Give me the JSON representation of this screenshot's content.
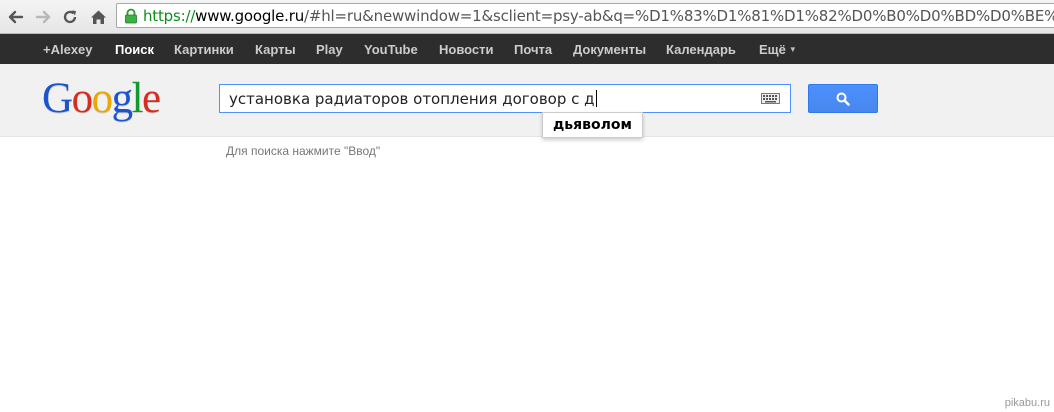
{
  "browser": {
    "url_scheme": "https://",
    "url_host": "www.google.ru",
    "url_rest": "/#hl=ru&newwindow=1&sclient=psy-ab&q=%D1%83%D1%81%D1%82%D0%B0%D0%BD%D0%BE%D0%B2%D0%"
  },
  "gbar": {
    "items": [
      {
        "label": "+Alexey"
      },
      {
        "label": "Поиск"
      },
      {
        "label": "Картинки"
      },
      {
        "label": "Карты"
      },
      {
        "label": "Play"
      },
      {
        "label": "YouTube"
      },
      {
        "label": "Новости"
      },
      {
        "label": "Почта"
      },
      {
        "label": "Документы"
      },
      {
        "label": "Календарь"
      },
      {
        "label": "Ещё"
      }
    ]
  },
  "logo": {
    "letters": [
      "G",
      "o",
      "o",
      "g",
      "l",
      "e"
    ],
    "colors": [
      "#1a54d1",
      "#d62d20",
      "#e8a800",
      "#1a54d1",
      "#119a2c",
      "#d62d20"
    ]
  },
  "search": {
    "query": "установка радиаторов отопления договор с д",
    "suggestion": "дьяволом",
    "hint": "Для поиска нажмите \"Ввод\""
  },
  "watermark": "pikabu.ru",
  "colors": {
    "accent": "#4d90fe",
    "gbar_bg": "#2d2d2d",
    "header_bg": "#f1f1f1"
  }
}
